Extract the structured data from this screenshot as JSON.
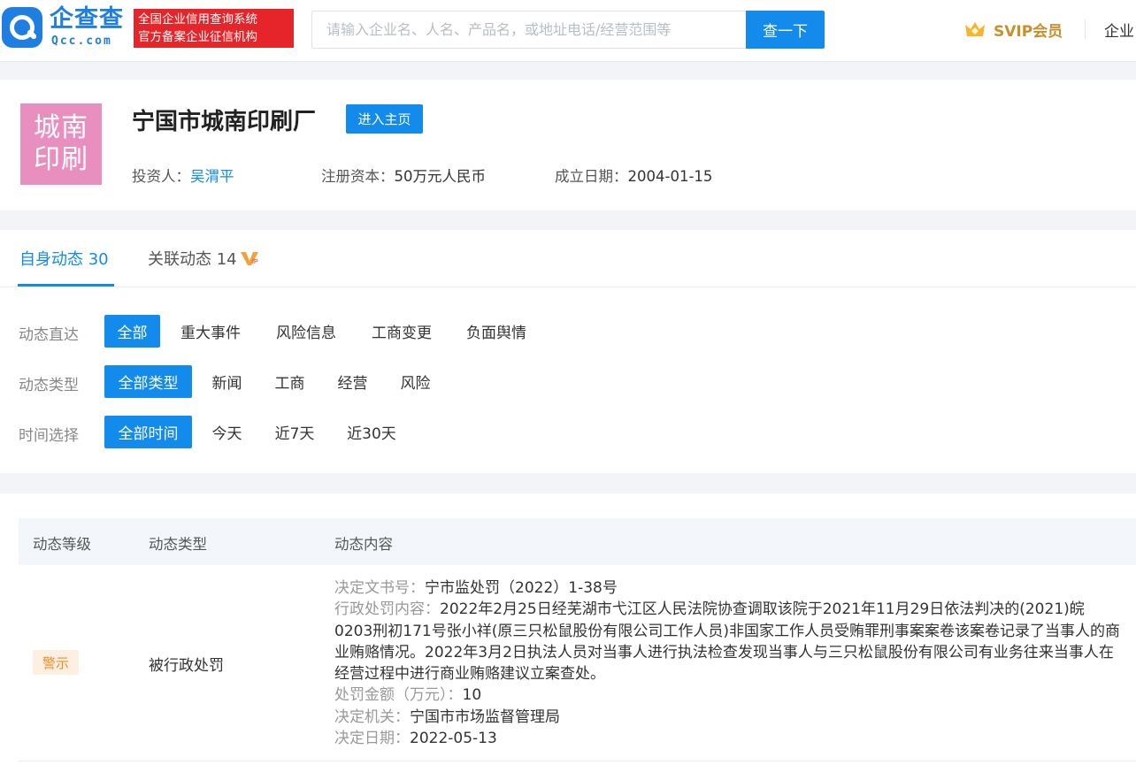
{
  "header": {
    "brand_name": "企查查",
    "brand_sub": "Qcc.com",
    "slogan_line1": "全国企业信用查询系统",
    "slogan_line2": "官方备案企业征信机构",
    "search_placeholder": "请输入企业名、人名、产品名，或地址电话/经营范围等",
    "search_button": "查一下",
    "svip_label": "SVIP会员",
    "right_link": "企业"
  },
  "company": {
    "logo_line1": "城南",
    "logo_line2": "印刷",
    "name": "宁国市城南印刷厂",
    "home_button": "进入主页",
    "investor_label": "投资人：",
    "investor_value": "吴渭平",
    "capital_label": "注册资本：",
    "capital_value": "50万元人民币",
    "founded_label": "成立日期：",
    "founded_value": "2004-01-15"
  },
  "tabs": [
    {
      "label": "自身动态 30",
      "active": true
    },
    {
      "label": "关联动态 14",
      "active": false
    }
  ],
  "filters": {
    "direct": {
      "label": "动态直达",
      "options": [
        "全部",
        "重大事件",
        "风险信息",
        "工商变更",
        "负面舆情"
      ]
    },
    "type": {
      "label": "动态类型",
      "options": [
        "全部类型",
        "新闻",
        "工商",
        "经营",
        "风险"
      ]
    },
    "time": {
      "label": "时间选择",
      "options": [
        "全部时间",
        "今天",
        "近7天",
        "近30天"
      ]
    }
  },
  "table": {
    "headers": [
      "动态等级",
      "动态类型",
      "动态内容"
    ],
    "row": {
      "level": "警示",
      "type": "被行政处罚",
      "doc_label": "决定文书号：",
      "doc_value": "宁市监处罚（2022）1-38号",
      "content_label": "行政处罚内容：",
      "content_value": "2022年2月25日经芜湖市弋江区人民法院协查调取该院于2021年11月29日依法判决的(2021)皖0203刑初171号张小祥(原三只松鼠股份有限公司工作人员)非国家工作人员受贿罪刑事案案卷该案卷记录了当事人的商业贿赂情况。2022年3月2日执法人员对当事人进行执法检查发现当事人与三只松鼠股份有限公司有业务往来当事人在经营过程中进行商业贿赂建议立案查处。",
      "amount_label": "处罚金额（万元）：",
      "amount_value": "10",
      "authority_label": "决定机关：",
      "authority_value": "宁国市市场监督管理局",
      "date_label": "决定日期：",
      "date_value": "2022-05-13"
    }
  },
  "colors": {
    "primary": "#128bed",
    "slogan_red": "#e5252a",
    "svip_gold": "#c8902b",
    "warning_orange": "#f08c2b",
    "logo_pink": "#e98fc0"
  }
}
